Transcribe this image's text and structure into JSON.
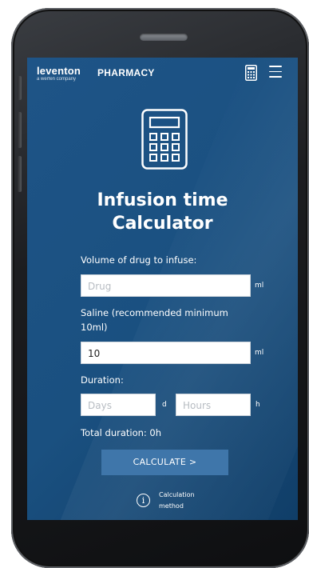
{
  "header": {
    "brand": "leventon",
    "brand_sub": "a werfen company",
    "section": "PHARMACY"
  },
  "page": {
    "title_line1": "Infusion time",
    "title_line2": "Calculator"
  },
  "form": {
    "volume_label": "Volume of drug to infuse:",
    "volume_placeholder": "Drug",
    "volume_unit": "ml",
    "saline_label_line1": "Saline (recommended minimum",
    "saline_label_line2": "10ml)",
    "saline_value": "10",
    "saline_unit": "ml",
    "duration_label": "Duration:",
    "days_placeholder": "Days",
    "days_unit": "d",
    "hours_placeholder": "Hours",
    "hours_unit": "h",
    "total_duration": "Total duration: 0h",
    "calculate_label": "CALCULATE >",
    "method_line1": "Calculation",
    "method_line2": "method"
  },
  "icons": {
    "header_calculator": "calculator-icon",
    "menu": "hamburger-menu-icon",
    "hero": "calculator-icon",
    "info": "info-icon"
  },
  "colors": {
    "screen_bg": "#1e5487",
    "button_bg": "#3f76aa",
    "text": "#ffffff"
  }
}
